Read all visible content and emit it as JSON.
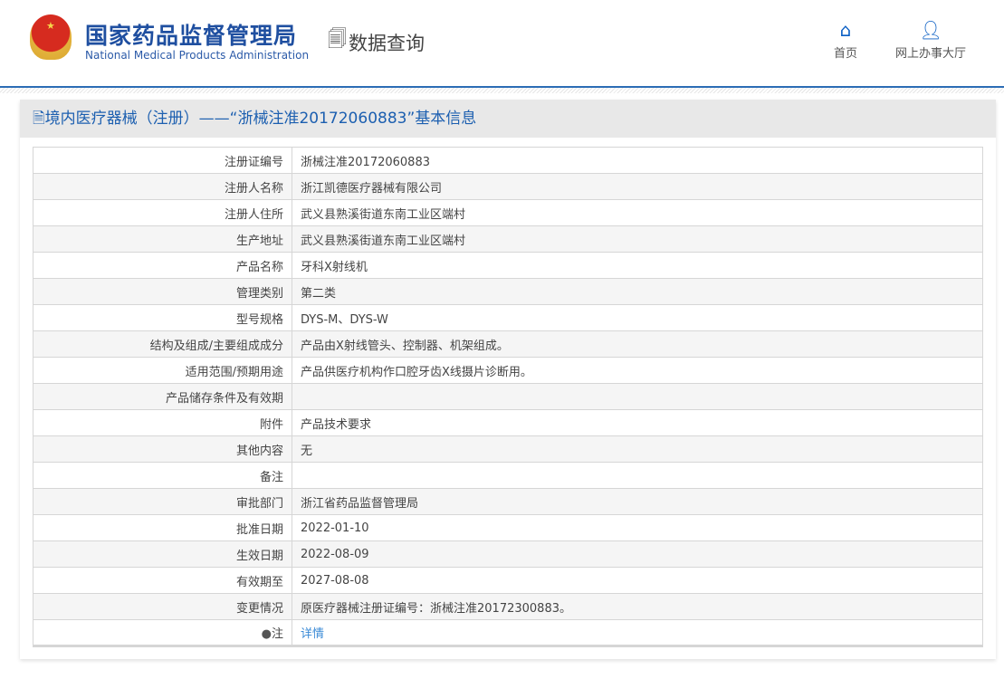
{
  "header": {
    "logo_cn": "国家药品监督管理局",
    "logo_en": "National Medical Products Administration",
    "section": "数据查询",
    "nav": [
      {
        "label": "首页",
        "icon": "home-icon"
      },
      {
        "label": "网上办事大厅",
        "icon": "user-icon"
      }
    ]
  },
  "panel": {
    "title": "境内医疗器械（注册）——“浙械注准20172060883”基本信息"
  },
  "rows": [
    {
      "label": "注册证编号",
      "value": "浙械注准20172060883"
    },
    {
      "label": "注册人名称",
      "value": "浙江凯德医疗器械有限公司"
    },
    {
      "label": "注册人住所",
      "value": "武义县熟溪街道东南工业区端村"
    },
    {
      "label": "生产地址",
      "value": "武义县熟溪街道东南工业区端村"
    },
    {
      "label": "产品名称",
      "value": "牙科X射线机"
    },
    {
      "label": "管理类别",
      "value": "第二类"
    },
    {
      "label": "型号规格",
      "value": "DYS-M、DYS-W"
    },
    {
      "label": "结构及组成/主要组成成分",
      "value": "产品由X射线管头、控制器、机架组成。"
    },
    {
      "label": "适用范围/预期用途",
      "value": "产品供医疗机构作口腔牙齿X线摄片诊断用。"
    },
    {
      "label": "产品储存条件及有效期",
      "value": ""
    },
    {
      "label": "附件",
      "value": "产品技术要求"
    },
    {
      "label": "其他内容",
      "value": "无"
    },
    {
      "label": "备注",
      "value": ""
    },
    {
      "label": "审批部门",
      "value": "浙江省药品监督管理局"
    },
    {
      "label": "批准日期",
      "value": "2022-01-10"
    },
    {
      "label": "生效日期",
      "value": "2022-08-09"
    },
    {
      "label": "有效期至",
      "value": "2027-08-08"
    },
    {
      "label": "变更情况",
      "value": "原医疗器械注册证编号：浙械注准20172300883。"
    }
  ],
  "note": {
    "label": "注",
    "link": "详情"
  }
}
